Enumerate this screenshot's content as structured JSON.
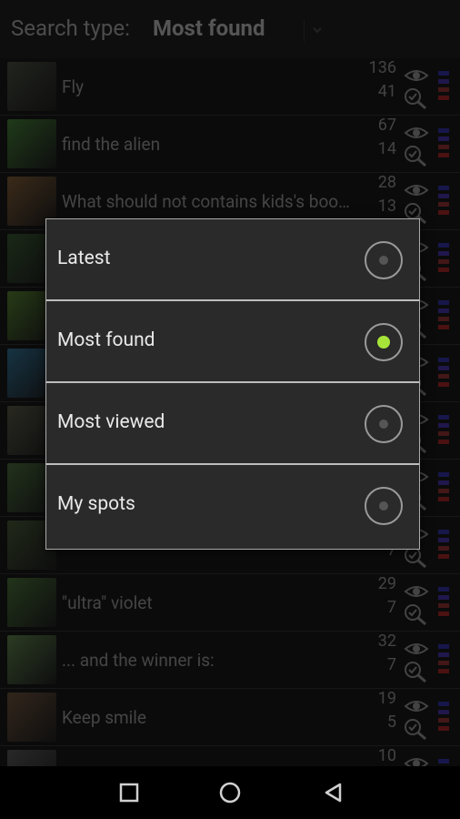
{
  "topbar": {
    "label": "Search type:",
    "value": "Most found"
  },
  "rows": [
    {
      "title": "Fly",
      "views": "136",
      "found": "41",
      "thumb": "#3d4236"
    },
    {
      "title": "find the alien",
      "views": "67",
      "found": "14",
      "thumb": "#3a6a2f"
    },
    {
      "title": "What should not contains kids's bookshelf",
      "views": "28",
      "found": "13",
      "thumb": "#6b4e2f"
    },
    {
      "title": "",
      "views": "",
      "found": "",
      "thumb": "#2f4a2a"
    },
    {
      "title": "",
      "views": "",
      "found": "",
      "thumb": "#476a29"
    },
    {
      "title": "",
      "views": "",
      "found": "",
      "thumb": "#2a5d7a"
    },
    {
      "title": "",
      "views": "",
      "found": "",
      "thumb": "#4a4a3d"
    },
    {
      "title": "",
      "views": "",
      "found": "",
      "thumb": "#3f5b33"
    },
    {
      "title": "",
      "views": "",
      "found": "7",
      "thumb": "#3b4a2f"
    },
    {
      "title": "\"ultra\" violet",
      "views": "29",
      "found": "7",
      "thumb": "#3e5f30"
    },
    {
      "title": "... and the winner is:",
      "views": "32",
      "found": "7",
      "thumb": "#4f6d40"
    },
    {
      "title": "Keep smile",
      "views": "19",
      "found": "5",
      "thumb": "#5b4532"
    },
    {
      "title": "",
      "views": "10",
      "found": "",
      "thumb": "#4a4a4a"
    }
  ],
  "dialog": {
    "options": [
      {
        "label": "Latest",
        "selected": false
      },
      {
        "label": "Most found",
        "selected": true
      },
      {
        "label": "Most viewed",
        "selected": false
      },
      {
        "label": "My spots",
        "selected": false
      }
    ]
  },
  "colors": {
    "accent": "#a7e43a",
    "bars": [
      "#2a2a8a",
      "#3b2b8a",
      "#7a2a2a",
      "#8a2020"
    ]
  },
  "icons": {
    "views": "eye-icon",
    "found": "magnifier-check-icon",
    "nav_back": "triangle-left-icon",
    "nav_home": "circle-icon",
    "nav_recent": "square-icon"
  }
}
